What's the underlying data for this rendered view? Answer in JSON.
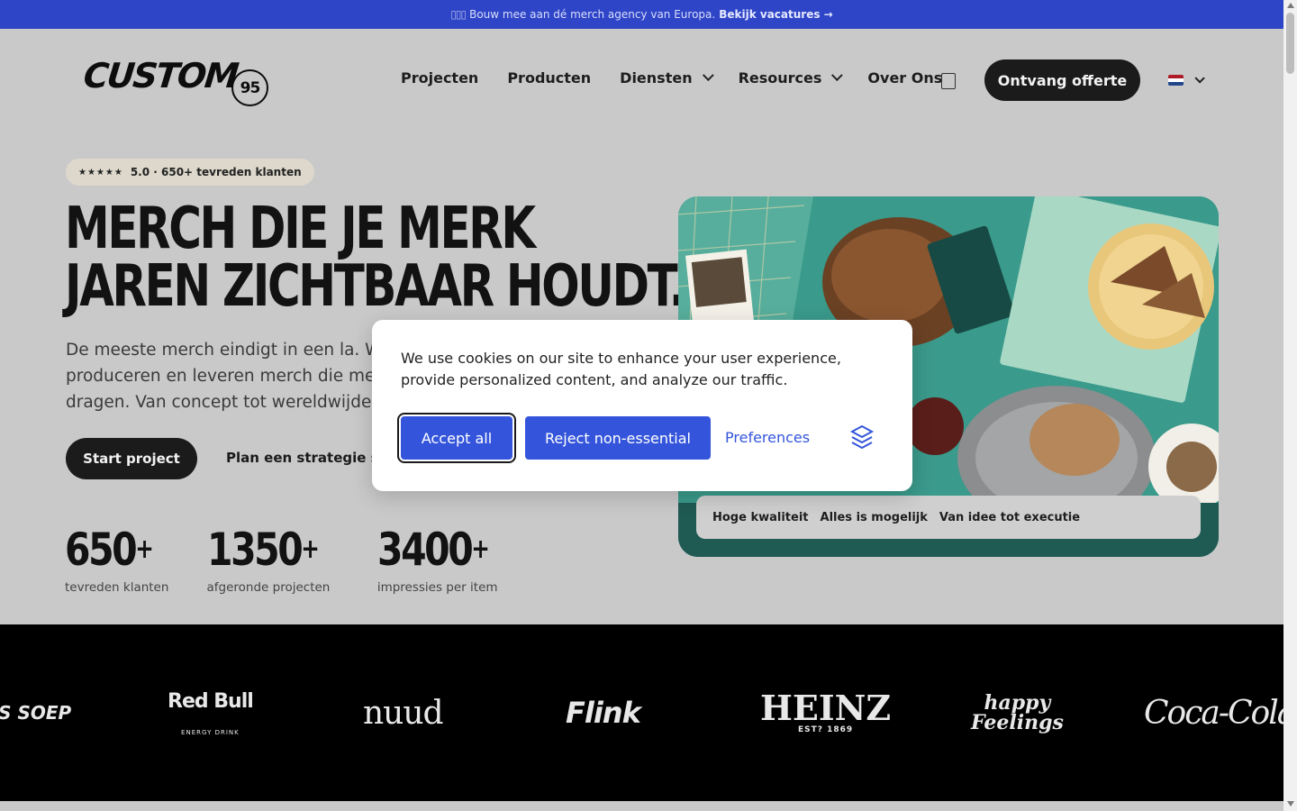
{
  "announcement": {
    "emoji": "▯▯▯",
    "text": "Bouw mee aan dé merch agency van Europa.",
    "cta": "Bekijk vacatures →"
  },
  "header": {
    "logo_text": "CUSTOM",
    "logo_badge": "95",
    "nav": [
      {
        "label": "Projecten"
      },
      {
        "label": "Producten"
      },
      {
        "label": "Diensten"
      },
      {
        "label": "Resources"
      },
      {
        "label": "Over Ons"
      }
    ],
    "quote_button": "Ontvang offerte",
    "flag_colors": [
      "#ae1c28",
      "#ffffff",
      "#21468b"
    ]
  },
  "hero": {
    "rating_stars": "★★★★★",
    "rating_text": "5.0 · 650+ tevreden klanten",
    "headline_line1": "MERCH DIE JE MERK",
    "headline_line2": "JAREN ZICHTBAAR HOUDT.",
    "lead": "De meeste merch eindigt in een la. Wij ontwerpen, produceren en leveren merch die mensen écht willen dragen. Van concept tot wereldwijde distributie.",
    "start_button": "Start project",
    "strategy_link": "Plan een strategie sessie",
    "usps": [
      "Hoge kwaliteit",
      "Alles is mogelijk",
      "Van idee tot executie"
    ]
  },
  "stats": [
    {
      "number": "650",
      "suffix": "+",
      "label": "tevreden klanten"
    },
    {
      "number": "1350",
      "suffix": "+",
      "label": "afgeronde projecten"
    },
    {
      "number": "3400",
      "suffix": "+",
      "label": "impressies per item"
    }
  ],
  "brands": [
    {
      "name": "'S SOEP",
      "icon": "soep-logo"
    },
    {
      "name": "Red Bull",
      "sub": "ENERGY DRINK",
      "icon": "redbull-logo"
    },
    {
      "name": "nuud",
      "icon": "nuud-logo"
    },
    {
      "name": "Flink",
      "icon": "flink-logo"
    },
    {
      "name": "HEINZ",
      "sub": "EST? 1869",
      "icon": "heinz-logo"
    },
    {
      "name": "happy",
      "sub": "Feelings",
      "icon": "happy-feelings-logo"
    },
    {
      "name": "Coca-Cola",
      "icon": "coca-cola-logo"
    }
  ],
  "cookie": {
    "text": "We use cookies on our site to enhance your user experience, provide personalized content, and analyze our traffic.",
    "accept": "Accept all",
    "reject": "Reject non-essential",
    "preferences": "Preferences"
  },
  "colors": {
    "topbar": "#2f45c7",
    "accent": "#3455db",
    "dark_button": "#1b1b1b",
    "page_overlay": "#c9c9c9"
  }
}
